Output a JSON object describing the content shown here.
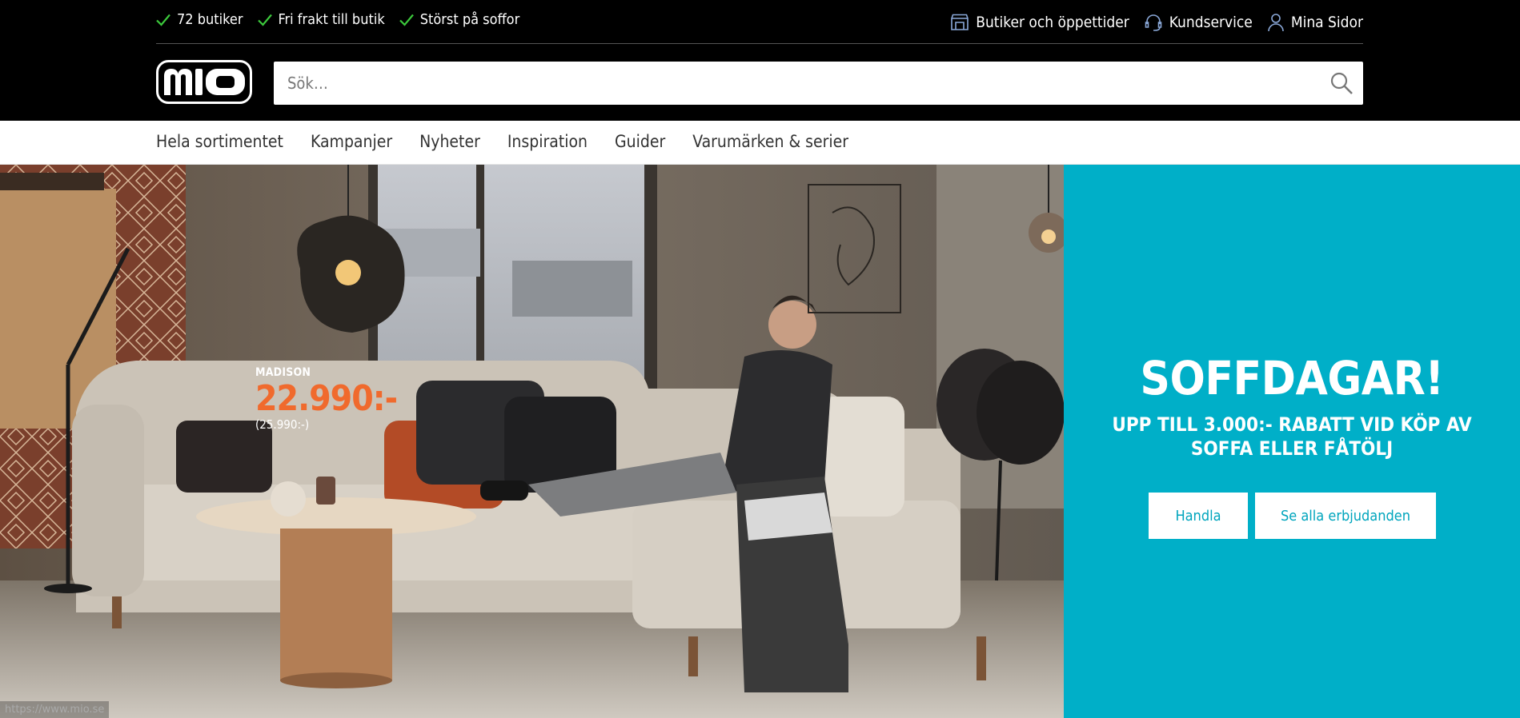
{
  "header": {
    "usps": [
      {
        "label": "72 butiker"
      },
      {
        "label": "Fri frakt till butik"
      },
      {
        "label": "Störst på soffor"
      }
    ],
    "utility_links": {
      "stores": "Butiker och öppettider",
      "customer_service": "Kundservice",
      "my_pages": "Mina Sidor"
    },
    "logo_text": "mio",
    "search": {
      "placeholder": "Sök…",
      "value": ""
    }
  },
  "nav": {
    "items": [
      {
        "label": "Hela sortimentet"
      },
      {
        "label": "Kampanjer"
      },
      {
        "label": "Nyheter"
      },
      {
        "label": "Inspiration"
      },
      {
        "label": "Guider"
      },
      {
        "label": "Varumärken & serier"
      }
    ]
  },
  "hero": {
    "product": {
      "name": "MADISON",
      "price": "22.990:-",
      "old_price": "(25.990:-)"
    },
    "promo": {
      "title": "SOFFDAGAR!",
      "subtitle": "UPP TILL 3.000:- RABATT VID KÖP AV SOFFA ELLER FÅTÖLJ",
      "shop_label": "Handla",
      "offers_label": "Se alla erbjudanden"
    },
    "status_url": "https://www.mio.se"
  },
  "colors": {
    "header_bg": "#000000",
    "check_green": "#3cc93c",
    "promo_bg": "#00afc8",
    "price_orange": "#f06a2d",
    "button_text": "#00a5bd"
  }
}
